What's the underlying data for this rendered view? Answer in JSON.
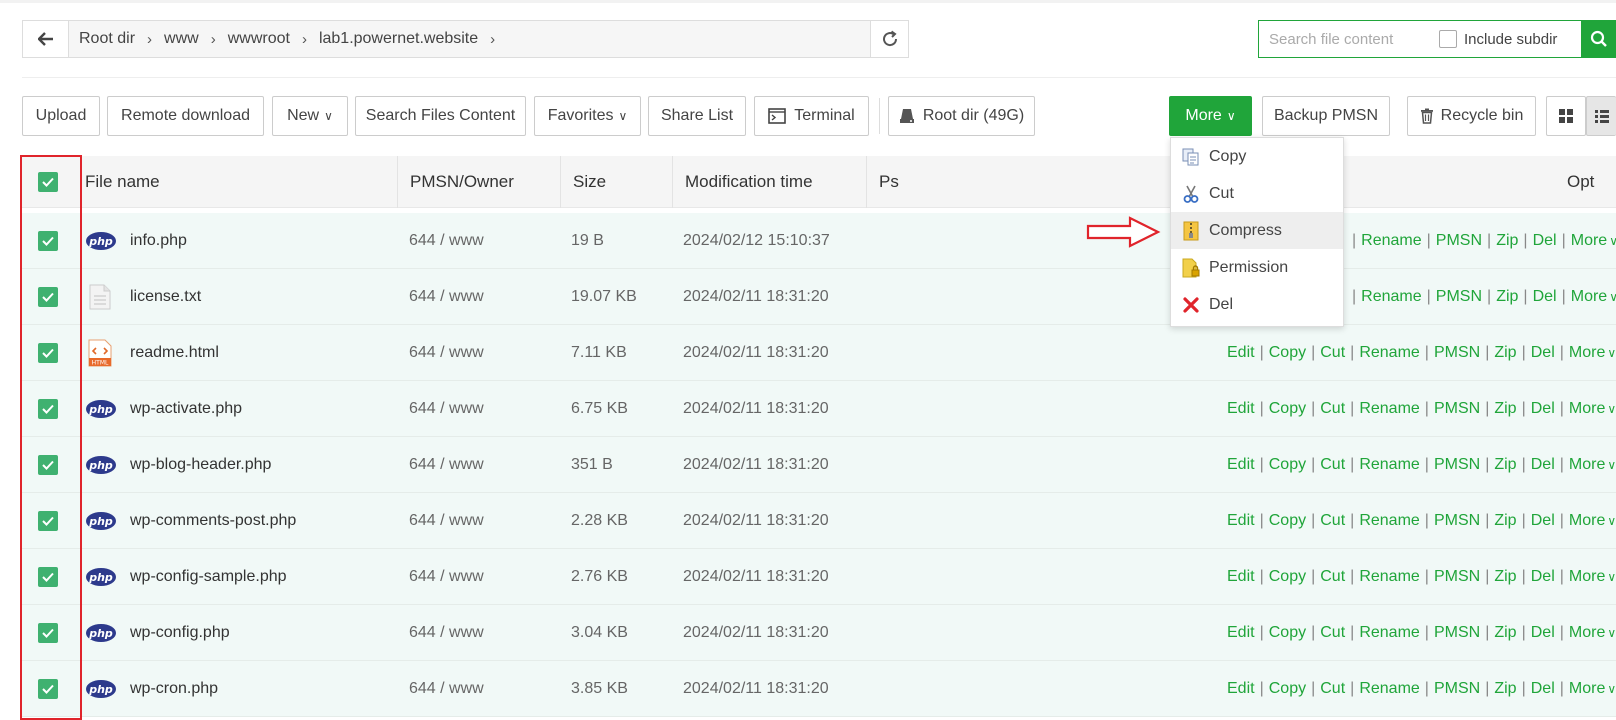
{
  "breadcrumb": {
    "items": [
      "Root dir",
      "www",
      "wwwroot",
      "lab1.powernet.website"
    ]
  },
  "search": {
    "placeholder": "Search file content",
    "include_subdir": "Include subdir"
  },
  "toolbar": {
    "upload": "Upload",
    "remote_download": "Remote download",
    "new": "New",
    "search_files": "Search Files Content",
    "favorites": "Favorites",
    "share_list": "Share List",
    "terminal": "Terminal",
    "root_dir": "Root dir (49G)",
    "more": "More",
    "backup_pmsn": "Backup PMSN",
    "recycle_bin": "Recycle bin"
  },
  "table": {
    "headers": {
      "name": "File name",
      "owner": "PMSN/Owner",
      "size": "Size",
      "mtime": "Modification time",
      "ps": "Ps",
      "opt": "Opt"
    },
    "rows": [
      {
        "icon": "php",
        "name": "info.php",
        "owner": "644 / www",
        "size": "19 B",
        "mtime": "2024/02/12 15:10:37"
      },
      {
        "icon": "txt",
        "name": "license.txt",
        "owner": "644 / www",
        "size": "19.07 KB",
        "mtime": "2024/02/11 18:31:20"
      },
      {
        "icon": "html",
        "name": "readme.html",
        "owner": "644 / www",
        "size": "7.11 KB",
        "mtime": "2024/02/11 18:31:20"
      },
      {
        "icon": "php",
        "name": "wp-activate.php",
        "owner": "644 / www",
        "size": "6.75 KB",
        "mtime": "2024/02/11 18:31:20"
      },
      {
        "icon": "php",
        "name": "wp-blog-header.php",
        "owner": "644 / www",
        "size": "351 B",
        "mtime": "2024/02/11 18:31:20"
      },
      {
        "icon": "php",
        "name": "wp-comments-post.php",
        "owner": "644 / www",
        "size": "2.28 KB",
        "mtime": "2024/02/11 18:31:20"
      },
      {
        "icon": "php",
        "name": "wp-config-sample.php",
        "owner": "644 / www",
        "size": "2.76 KB",
        "mtime": "2024/02/11 18:31:20"
      },
      {
        "icon": "php",
        "name": "wp-config.php",
        "owner": "644 / www",
        "size": "3.04 KB",
        "mtime": "2024/02/11 18:31:20"
      },
      {
        "icon": "php",
        "name": "wp-cron.php",
        "owner": "644 / www",
        "size": "3.85 KB",
        "mtime": "2024/02/11 18:31:20"
      }
    ],
    "ops": [
      "Edit",
      "Copy",
      "Cut",
      "Rename",
      "PMSN",
      "Zip",
      "Del",
      "More"
    ],
    "php_label": "php",
    "html_label": "HTML"
  },
  "dropdown": {
    "items": [
      {
        "label": "Copy",
        "icon": "copy-icon"
      },
      {
        "label": "Cut",
        "icon": "scissors-icon"
      },
      {
        "label": "Compress",
        "icon": "zip-icon",
        "highlighted": true
      },
      {
        "label": "Permission",
        "icon": "permission-icon"
      },
      {
        "label": "Del",
        "icon": "delete-icon"
      }
    ]
  },
  "colors": {
    "accent": "#20a53a",
    "checkbox": "#3fb170",
    "highlight_box": "#e0242b",
    "row_bg": "#f1f9f7",
    "php_badge": "#2d3a8c"
  }
}
